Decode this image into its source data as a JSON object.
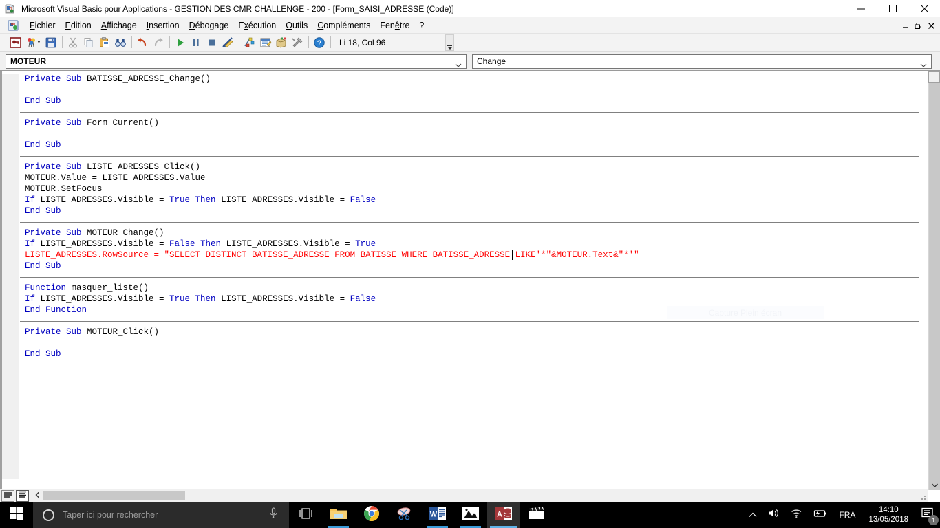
{
  "window": {
    "title": "Microsoft Visual Basic pour Applications - GESTION DES CMR CHALLENGE - 200 - [Form_SAISI_ADRESSE (Code)]",
    "minimize_label": "—",
    "maximize_label": "❐",
    "close_label": "✕",
    "mdi_minimize_label": "_",
    "mdi_restore_label": "❐",
    "mdi_close_label": "✕"
  },
  "menu": {
    "items": [
      {
        "label": "Fichier",
        "accel": "F"
      },
      {
        "label": "Edition",
        "accel": "E"
      },
      {
        "label": "Affichage",
        "accel": "A"
      },
      {
        "label": "Insertion",
        "accel": "I"
      },
      {
        "label": "Débogage",
        "accel": "D"
      },
      {
        "label": "Exécution",
        "accel": "x"
      },
      {
        "label": "Outils",
        "accel": "O"
      },
      {
        "label": "Compléments",
        "accel": "C"
      },
      {
        "label": "Fenêtre",
        "accel": "ê"
      },
      {
        "label": "?",
        "accel": ""
      }
    ]
  },
  "toolbar": {
    "status": "Li 18, Col 96",
    "buttons": [
      {
        "name": "view-object-button",
        "icon": "key-icon"
      },
      {
        "name": "insert-userform-button",
        "icon": "balloons-icon"
      },
      {
        "name": "save-button",
        "icon": "floppy-disk-icon"
      },
      {
        "name": "cut-button",
        "icon": "scissors-icon"
      },
      {
        "name": "copy-button",
        "icon": "copy-icon"
      },
      {
        "name": "paste-button",
        "icon": "clipboard-icon"
      },
      {
        "name": "find-button",
        "icon": "binoculars-icon"
      },
      {
        "name": "undo-button",
        "icon": "undo-arrow-icon"
      },
      {
        "name": "redo-button",
        "icon": "redo-arrow-icon"
      },
      {
        "name": "run-button",
        "icon": "play-triangle-icon"
      },
      {
        "name": "break-button",
        "icon": "pause-bars-icon"
      },
      {
        "name": "reset-button",
        "icon": "stop-square-icon"
      },
      {
        "name": "design-mode-button",
        "icon": "ruler-pencil-icon"
      },
      {
        "name": "project-explorer-button",
        "icon": "project-tree-icon"
      },
      {
        "name": "properties-window-button",
        "icon": "properties-sheet-icon"
      },
      {
        "name": "object-browser-button",
        "icon": "object-browser-icon"
      },
      {
        "name": "toolbox-button",
        "icon": "tools-hammer-icon"
      },
      {
        "name": "help-button",
        "icon": "question-mark-icon"
      }
    ]
  },
  "combos": {
    "object": {
      "value": "MOTEUR",
      "arrow": "chevron-down-icon"
    },
    "procedure": {
      "value": "Change",
      "arrow": "chevron-down-icon"
    }
  },
  "code": {
    "lines": [
      {
        "segments": [
          {
            "t": "Private Sub ",
            "c": "kw"
          },
          {
            "t": "BATISSE_ADRESSE_Change()",
            "c": ""
          }
        ]
      },
      {
        "segments": [
          {
            "t": "",
            "c": ""
          }
        ]
      },
      {
        "segments": [
          {
            "t": "End Sub",
            "c": "kw"
          }
        ]
      },
      {
        "sep": true,
        "segments": [
          {
            "t": "",
            "c": ""
          }
        ]
      },
      {
        "segments": [
          {
            "t": "Private Sub ",
            "c": "kw"
          },
          {
            "t": "Form_Current()",
            "c": ""
          }
        ]
      },
      {
        "segments": [
          {
            "t": "",
            "c": ""
          }
        ]
      },
      {
        "segments": [
          {
            "t": "End Sub",
            "c": "kw"
          }
        ]
      },
      {
        "sep": true,
        "segments": [
          {
            "t": "",
            "c": ""
          }
        ]
      },
      {
        "segments": [
          {
            "t": "Private Sub ",
            "c": "kw"
          },
          {
            "t": "LISTE_ADRESSES_Click()",
            "c": ""
          }
        ]
      },
      {
        "segments": [
          {
            "t": "MOTEUR.Value = LISTE_ADRESSES.Value",
            "c": ""
          }
        ]
      },
      {
        "segments": [
          {
            "t": "MOTEUR.SetFocus",
            "c": ""
          }
        ]
      },
      {
        "segments": [
          {
            "t": "If ",
            "c": "kw"
          },
          {
            "t": "LISTE_ADRESSES.Visible = ",
            "c": ""
          },
          {
            "t": "True Then ",
            "c": "kw"
          },
          {
            "t": "LISTE_ADRESSES.Visible = ",
            "c": ""
          },
          {
            "t": "False",
            "c": "kw"
          }
        ]
      },
      {
        "segments": [
          {
            "t": "End Sub",
            "c": "kw"
          }
        ]
      },
      {
        "sep": true,
        "segments": [
          {
            "t": "",
            "c": ""
          }
        ]
      },
      {
        "segments": [
          {
            "t": "Private Sub ",
            "c": "kw"
          },
          {
            "t": "MOTEUR_Change()",
            "c": ""
          }
        ]
      },
      {
        "segments": [
          {
            "t": "If ",
            "c": "kw"
          },
          {
            "t": "LISTE_ADRESSES.Visible = ",
            "c": ""
          },
          {
            "t": "False Then ",
            "c": "kw"
          },
          {
            "t": "LISTE_ADRESSES.Visible = ",
            "c": ""
          },
          {
            "t": "True",
            "c": "kw"
          }
        ]
      },
      {
        "caret_col": 96,
        "segments": [
          {
            "t": "LISTE_ADRESSES.RowSource = \"SELECT DISTINCT BATISSE_ADRESSE FROM BATISSE WHERE BATISSE_ADRESSE LIKE'*\"&MOTEUR.Text&\"*'\"",
            "c": "err"
          }
        ]
      },
      {
        "segments": [
          {
            "t": "End Sub",
            "c": "kw"
          }
        ]
      },
      {
        "sep": true,
        "segments": [
          {
            "t": "",
            "c": ""
          }
        ]
      },
      {
        "segments": [
          {
            "t": "Function ",
            "c": "kw"
          },
          {
            "t": "masquer_liste()",
            "c": ""
          }
        ]
      },
      {
        "segments": [
          {
            "t": "If ",
            "c": "kw"
          },
          {
            "t": "LISTE_ADRESSES.Visible = ",
            "c": ""
          },
          {
            "t": "True Then ",
            "c": "kw"
          },
          {
            "t": "LISTE_ADRESSES.Visible = ",
            "c": ""
          },
          {
            "t": "False",
            "c": "kw"
          }
        ]
      },
      {
        "segments": [
          {
            "t": "End Function",
            "c": "kw"
          }
        ]
      },
      {
        "sep": true,
        "segments": [
          {
            "t": "",
            "c": ""
          }
        ]
      },
      {
        "segments": [
          {
            "t": "Private Sub ",
            "c": "kw"
          },
          {
            "t": "MOTEUR_Click()",
            "c": ""
          }
        ]
      },
      {
        "segments": [
          {
            "t": "",
            "c": ""
          }
        ]
      },
      {
        "segments": [
          {
            "t": "End Sub",
            "c": "kw"
          }
        ]
      }
    ],
    "watermark": "Capture Plein écran"
  },
  "scrollbars": {
    "v_up": "scroll-up-arrow-icon",
    "v_down": "scroll-down-arrow-icon",
    "h_left": "scroll-left-arrow-icon"
  },
  "view_buttons": {
    "procedure_view": "procedure-view-icon",
    "full_module_view": "full-module-view-icon"
  },
  "taskbar": {
    "start": "windows-logo-icon",
    "search_placeholder": "Taper ici pour rechercher",
    "cortana": "cortana-circle-icon",
    "mic": "microphone-icon",
    "task_view": "task-view-icon",
    "apps": [
      {
        "name": "file-explorer",
        "icon": "folder-icon",
        "running": true,
        "active": false
      },
      {
        "name": "google-chrome",
        "icon": "chrome-icon",
        "running": false,
        "active": false
      },
      {
        "name": "snipping-tool",
        "icon": "scissors-tool-icon",
        "running": false,
        "active": false
      },
      {
        "name": "microsoft-word",
        "icon": "word-icon",
        "running": true,
        "active": false
      },
      {
        "name": "photos",
        "icon": "photos-icon",
        "running": true,
        "active": false
      },
      {
        "name": "microsoft-access",
        "icon": "access-icon",
        "running": true,
        "active": true
      },
      {
        "name": "movie-maker",
        "icon": "movie-clapper-icon",
        "running": false,
        "active": false
      }
    ],
    "tray": {
      "chevron": "show-hidden-icons-icon",
      "volume": "speaker-icon",
      "network": "wifi-icon",
      "battery": "battery-charging-icon",
      "language": "FRA",
      "time": "14:10",
      "date": "13/05/2018",
      "notifications": "action-center-icon",
      "notification_count": "1"
    }
  }
}
